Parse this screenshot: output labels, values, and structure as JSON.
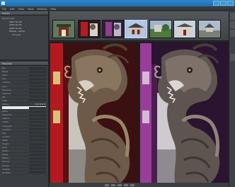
{
  "window": {
    "title": ""
  },
  "menu": [
    "File",
    "Edit",
    "View",
    "Tools",
    "Window",
    "Help"
  ],
  "left_panel": {
    "folders_header": "Folders",
    "folders": [
      {
        "label": "My Pictures",
        "level": 0
      },
      {
        "label": "2007-07-18",
        "level": 1
      },
      {
        "label": "2007-07-19",
        "level": 1
      },
      {
        "label": "2007-07-20",
        "level": 1
      },
      {
        "label": "Photos - China",
        "level": 1
      },
      {
        "label": "Temples",
        "level": 2
      }
    ],
    "metadata_header": "Metadata",
    "metadata_rows": [
      "File",
      "Name",
      "Date",
      "Size",
      "Camera",
      "Lens",
      "Exposure",
      "Aperture",
      "ISO",
      "Flash",
      "Rating",
      "",
      "Label",
      "Keywords",
      "Caption",
      "Author",
      "Copyright",
      "Location",
      "City",
      "Country",
      "Width",
      "Height",
      "Color",
      "Profile",
      "Notes",
      "Status",
      "Format",
      "Version",
      "Created",
      "Modified"
    ],
    "rating_stars": "★★★★★"
  },
  "filmstrip": {
    "thumbnails": [
      {
        "name": "temple-gate",
        "selected": false
      },
      {
        "name": "red-door",
        "selected": false
      },
      {
        "name": "purple-hall",
        "selected": false
      },
      {
        "name": "temple-roof",
        "selected": true
      },
      {
        "name": "garden",
        "selected": false
      },
      {
        "name": "building",
        "selected": false
      },
      {
        "name": "courtyard",
        "selected": false
      }
    ]
  },
  "colors": {
    "titlebar": "#2e86c8",
    "panel": "#3a3d41",
    "dragon_left_door": "#c2161c",
    "dragon_right_door": "#9a3d9a"
  }
}
